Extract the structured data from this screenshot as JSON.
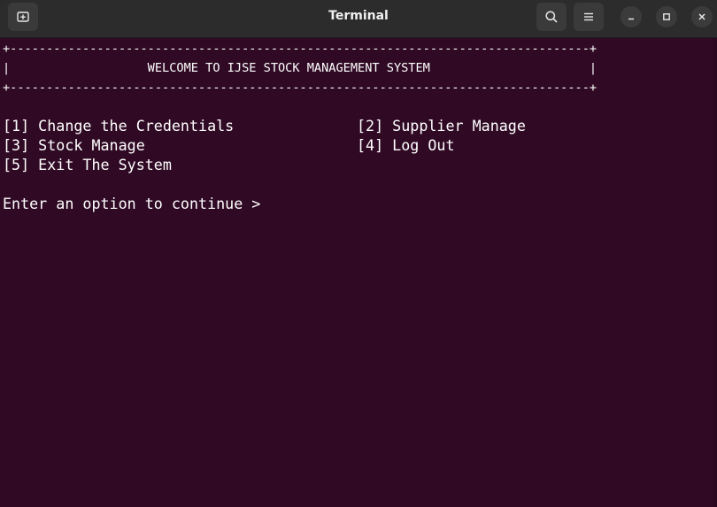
{
  "window": {
    "title": "Terminal"
  },
  "icons": {
    "new_tab": "new-tab-icon",
    "search": "search-icon",
    "menu": "hamburger-menu-icon",
    "minimize": "minimize-icon",
    "maximize": "maximize-icon",
    "close": "close-icon"
  },
  "colors": {
    "terminal_background": "#300a24",
    "titlebar_background": "#2c2c2c",
    "terminal_text": "#ffffff"
  },
  "terminal": {
    "border_top": "+--------------------------------------------------------------------------------+",
    "banner": "|                   WELCOME TO IJSE STOCK MANAGEMENT SYSTEM                      |",
    "border_bottom": "+--------------------------------------------------------------------------------+",
    "options": {
      "opt1": "[1] Change the Credentials",
      "opt2": "[2] Supplier Manage",
      "opt3": "[3] Stock Manage",
      "opt4": "[4] Log Out",
      "opt5": "[5] Exit The System"
    },
    "prompt": "Enter an option to continue >"
  }
}
